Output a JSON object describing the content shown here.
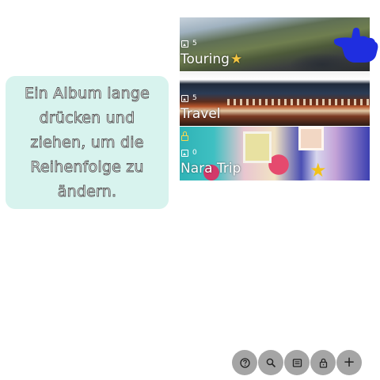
{
  "tooltip": {
    "text": "Ein Album lange drücken und ziehen, um die Reihenfolge zu ändern."
  },
  "albums": [
    {
      "title": "Touring",
      "count": "5",
      "starred": true,
      "locked": false
    },
    {
      "title": "Travel",
      "count": "5",
      "starred": false,
      "locked": false
    },
    {
      "title": "Nara Trip",
      "count": "0",
      "starred": false,
      "locked": true
    }
  ],
  "toolbar": {
    "buttons": [
      {
        "icon": "help-icon"
      },
      {
        "icon": "search-icon"
      },
      {
        "icon": "view-icon"
      },
      {
        "icon": "lock-icon"
      },
      {
        "icon": "add-icon",
        "label": "+"
      }
    ]
  },
  "colors": {
    "tooltip_bg": "#d8f3ee",
    "button_bg": "#a5a5a5",
    "hand": "#1f2ee0",
    "star": "#f4c542",
    "lock": "#ffd84a"
  }
}
